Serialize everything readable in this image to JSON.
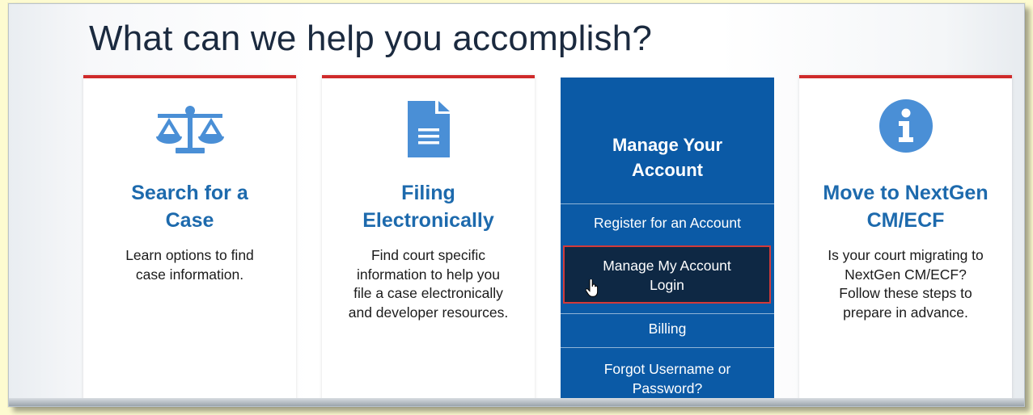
{
  "heading": "What can we help you accomplish?",
  "cards": [
    {
      "icon": "scales-icon",
      "title_line1": "Search for a",
      "title_line2": "Case",
      "desc_line1": "Learn options to find",
      "desc_line2": "case information."
    },
    {
      "icon": "document-icon",
      "title_line1": "Filing",
      "title_line2": "Electronically",
      "desc_line1": "Find court specific",
      "desc_line2": "information to help you",
      "desc_line3": "file a case electronically",
      "desc_line4": "and developer resources."
    },
    {
      "title_line1": "Manage Your",
      "title_line2": "Account",
      "links": [
        {
          "label": "Register for an Account"
        },
        {
          "label_line1": "Manage My Account",
          "label_line2": "Login"
        },
        {
          "label": "Billing"
        },
        {
          "label_line1": "Forgot Username or",
          "label_line2": "Password?"
        }
      ]
    },
    {
      "icon": "info-icon",
      "title_line1": "Move to NextGen",
      "title_line2": "CM/ECF",
      "desc_line1": "Is your court migrating to",
      "desc_line2": "NextGen CM/ECF?",
      "desc_line3": "Follow these steps to",
      "desc_line4": "prepare in advance."
    }
  ],
  "colors": {
    "accent_red": "#cf2a2a",
    "title_blue": "#1d6aad",
    "panel_blue": "#0b5aa6",
    "active_navy": "#0e2844",
    "icon_blue": "#4a8fd6"
  }
}
